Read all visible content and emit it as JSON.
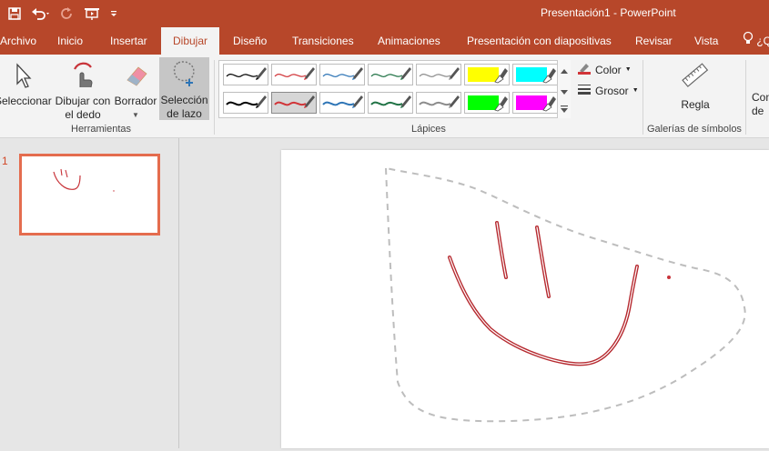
{
  "window": {
    "title": "Presentación1  -  PowerPoint"
  },
  "quick_access": [
    "save-icon",
    "undo-icon",
    "redo-icon",
    "start-from-beginning-icon",
    "customize-qat-icon"
  ],
  "tabs": [
    {
      "label": "Archivo"
    },
    {
      "label": "Inicio"
    },
    {
      "label": "Insertar"
    },
    {
      "label": "Dibujar",
      "active": true
    },
    {
      "label": "Diseño"
    },
    {
      "label": "Transiciones"
    },
    {
      "label": "Animaciones"
    },
    {
      "label": "Presentación con diapositivas"
    },
    {
      "label": "Revisar"
    },
    {
      "label": "Vista"
    },
    {
      "label": "¿Q"
    }
  ],
  "ribbon": {
    "herramientas": {
      "group_label": "Herramientas",
      "seleccionar": "Seleccionar",
      "dibujar_line1": "Dibujar con",
      "dibujar_line2": "el dedo",
      "borrador": "Borrador",
      "lazo_line1": "Selección",
      "lazo_line2": "de lazo"
    },
    "lapices": {
      "group_label": "Lápices",
      "color_label": "Color",
      "grosor_label": "Grosor"
    },
    "galerias": {
      "group_label": "Galerías de símbolos",
      "regla": "Regla"
    },
    "convertir": {
      "line1": "Con",
      "line2": "de"
    }
  },
  "pens": [
    {
      "color": "#000000",
      "type": "pen"
    },
    {
      "color": "#d13438",
      "type": "pen"
    },
    {
      "color": "#2e75b6",
      "type": "pen"
    },
    {
      "color": "#217346",
      "type": "pen"
    },
    {
      "color": "#8c8c8c",
      "type": "pen"
    },
    {
      "color": "#ffff00",
      "type": "highlighter"
    },
    {
      "color": "#00ffff",
      "type": "highlighter"
    },
    {
      "color": "#000000",
      "type": "pen"
    },
    {
      "color": "#d13438",
      "type": "pen",
      "selected": true
    },
    {
      "color": "#2e75b6",
      "type": "pen"
    },
    {
      "color": "#217346",
      "type": "pen"
    },
    {
      "color": "#8c8c8c",
      "type": "pen"
    },
    {
      "color": "#00ff00",
      "type": "highlighter"
    },
    {
      "color": "#ff00ff",
      "type": "highlighter"
    }
  ],
  "slides": [
    {
      "number": "1"
    }
  ],
  "colors": {
    "accent": "#b7472a",
    "ink": "#c8343a",
    "lasso": "#bdbdbd"
  }
}
